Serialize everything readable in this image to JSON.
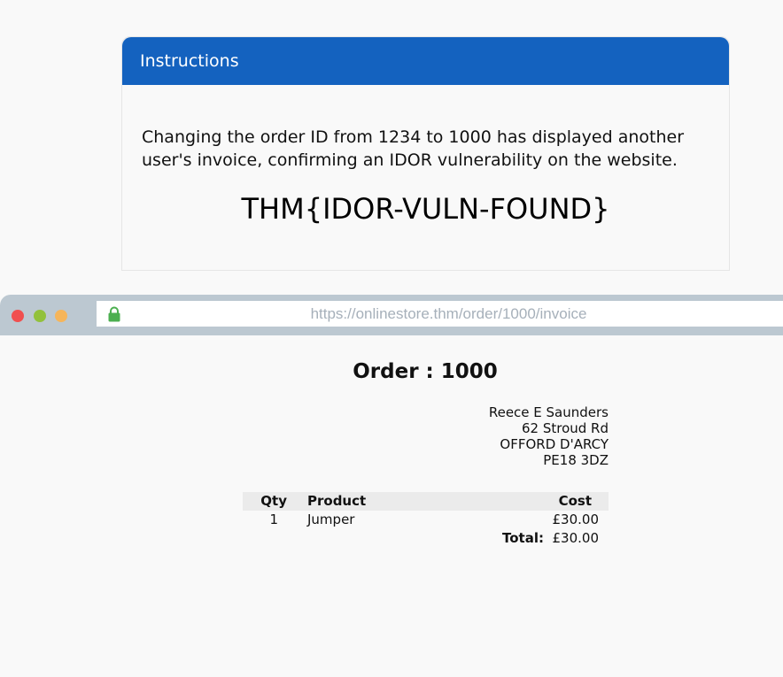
{
  "instructions": {
    "title": "Instructions",
    "text": "Changing the order ID from 1234 to 1000 has displayed another user's invoice, confirming an IDOR vulnerability on the website.",
    "flag": "THM{IDOR-VULN-FOUND}"
  },
  "browser": {
    "url": "https://onlinestore.thm/order/1000/invoice",
    "lock_icon": "lock-icon",
    "colors": {
      "close": "#f04f4f",
      "minimize": "#f6b55a",
      "maximize": "#92c13c"
    }
  },
  "invoice": {
    "title": "Order : 1000",
    "address": [
      "Reece E Saunders",
      "62 Stroud Rd",
      "OFFORD D'ARCY",
      "PE18 3DZ"
    ],
    "headers": {
      "qty": "Qty",
      "product": "Product",
      "cost": "Cost"
    },
    "rows": [
      {
        "qty": "1",
        "product": "Jumper",
        "cost": "£30.00"
      }
    ],
    "total_label": "Total:",
    "total_value": "£30.00"
  },
  "colors": {
    "header_blue": "#1462bf",
    "lock_green": "#4caf50"
  }
}
